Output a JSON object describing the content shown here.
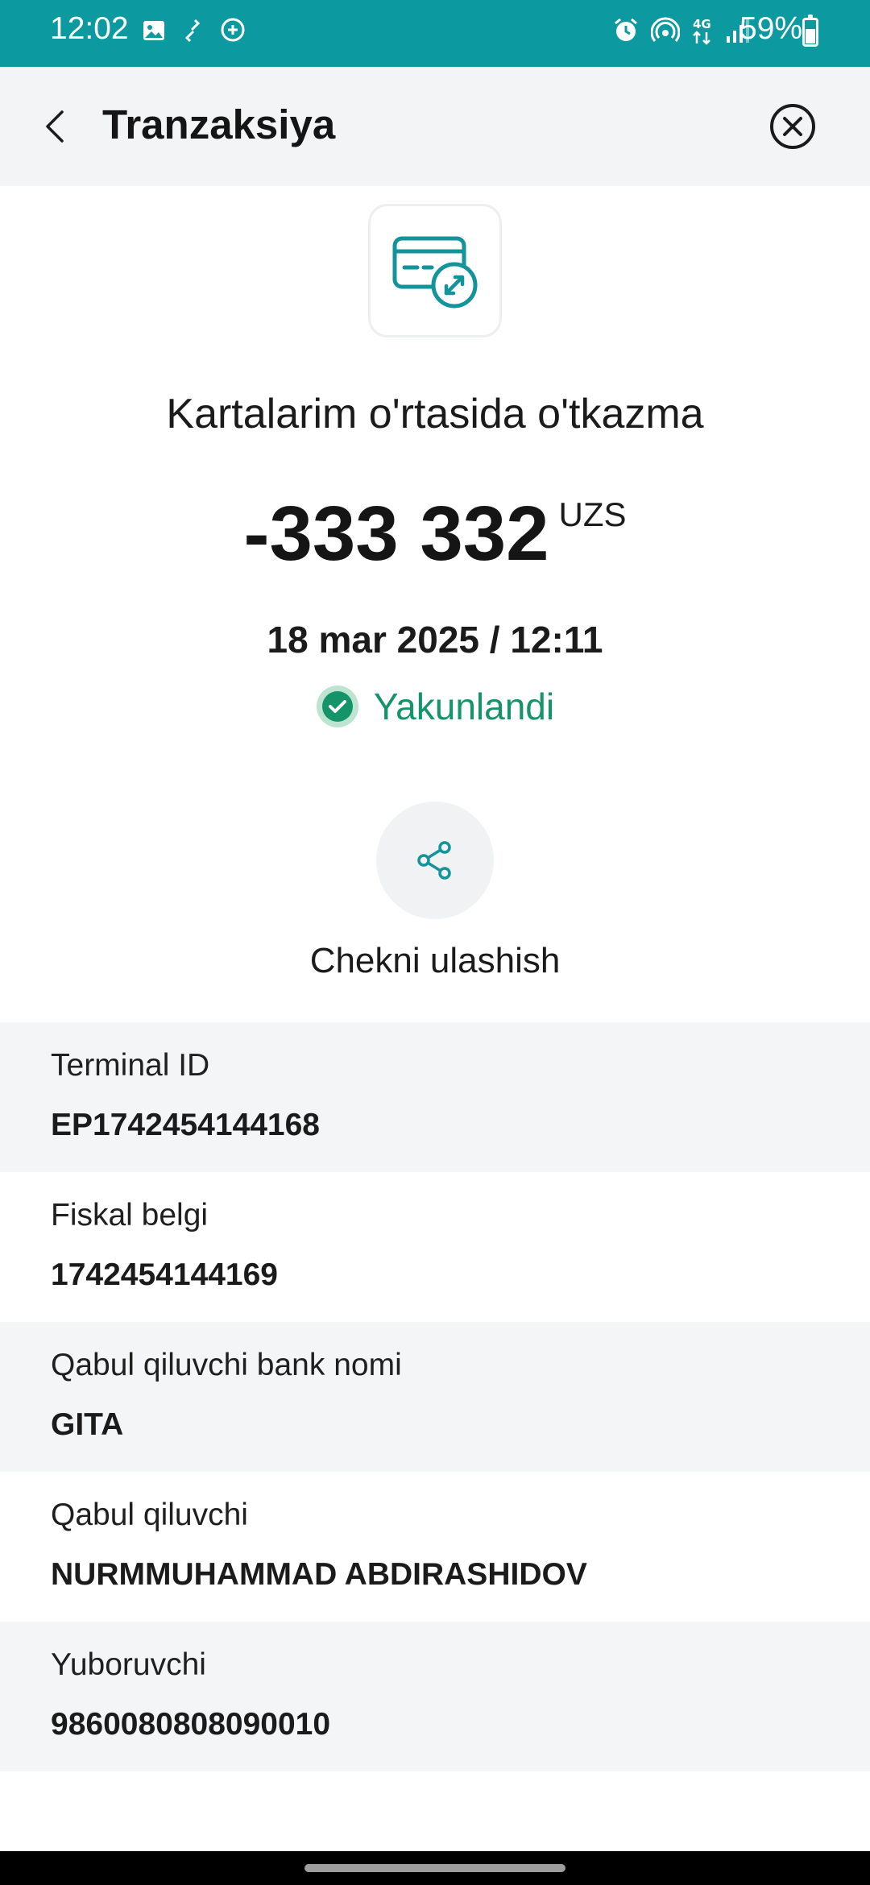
{
  "status_bar": {
    "time": "12:02",
    "battery": "59%",
    "left_icons": [
      "image-icon",
      "sync-icon",
      "chat-plus-icon"
    ],
    "right_icons": [
      "alarm-icon",
      "hotspot-icon",
      "4g-icon",
      "signal-icon",
      "battery-icon"
    ]
  },
  "header": {
    "title": "Tranzaksiya",
    "back_icon": "chevron-left-icon",
    "close_icon": "close-circle-icon"
  },
  "transaction": {
    "icon": "card-transfer-icon",
    "type": "Kartalarim o'rtasida o'tkazma",
    "amount": "-333 332",
    "currency": "UZS",
    "date": "18 mar 2025 / 12:11",
    "status": "Yakunlandi",
    "status_icon": "check-circle-icon",
    "status_color": "#15946a"
  },
  "share": {
    "icon": "share-icon",
    "label": "Chekni ulashish"
  },
  "details": [
    {
      "label": "Terminal ID",
      "value": "EP1742454144168"
    },
    {
      "label": "Fiskal belgi",
      "value": "1742454144169"
    },
    {
      "label": "Qabul qiluvchi bank nomi",
      "value": "GITA"
    },
    {
      "label": "Qabul qiluvchi",
      "value": "NURMMUHAMMAD ABDIRASHIDOV"
    },
    {
      "label": "Yuboruvchi",
      "value": "9860080808090010"
    }
  ],
  "colors": {
    "status_bar": "#0c9aa0",
    "accent": "#13939a",
    "header_bg": "#f3f4f6",
    "row_shade": "#f4f5f7"
  }
}
